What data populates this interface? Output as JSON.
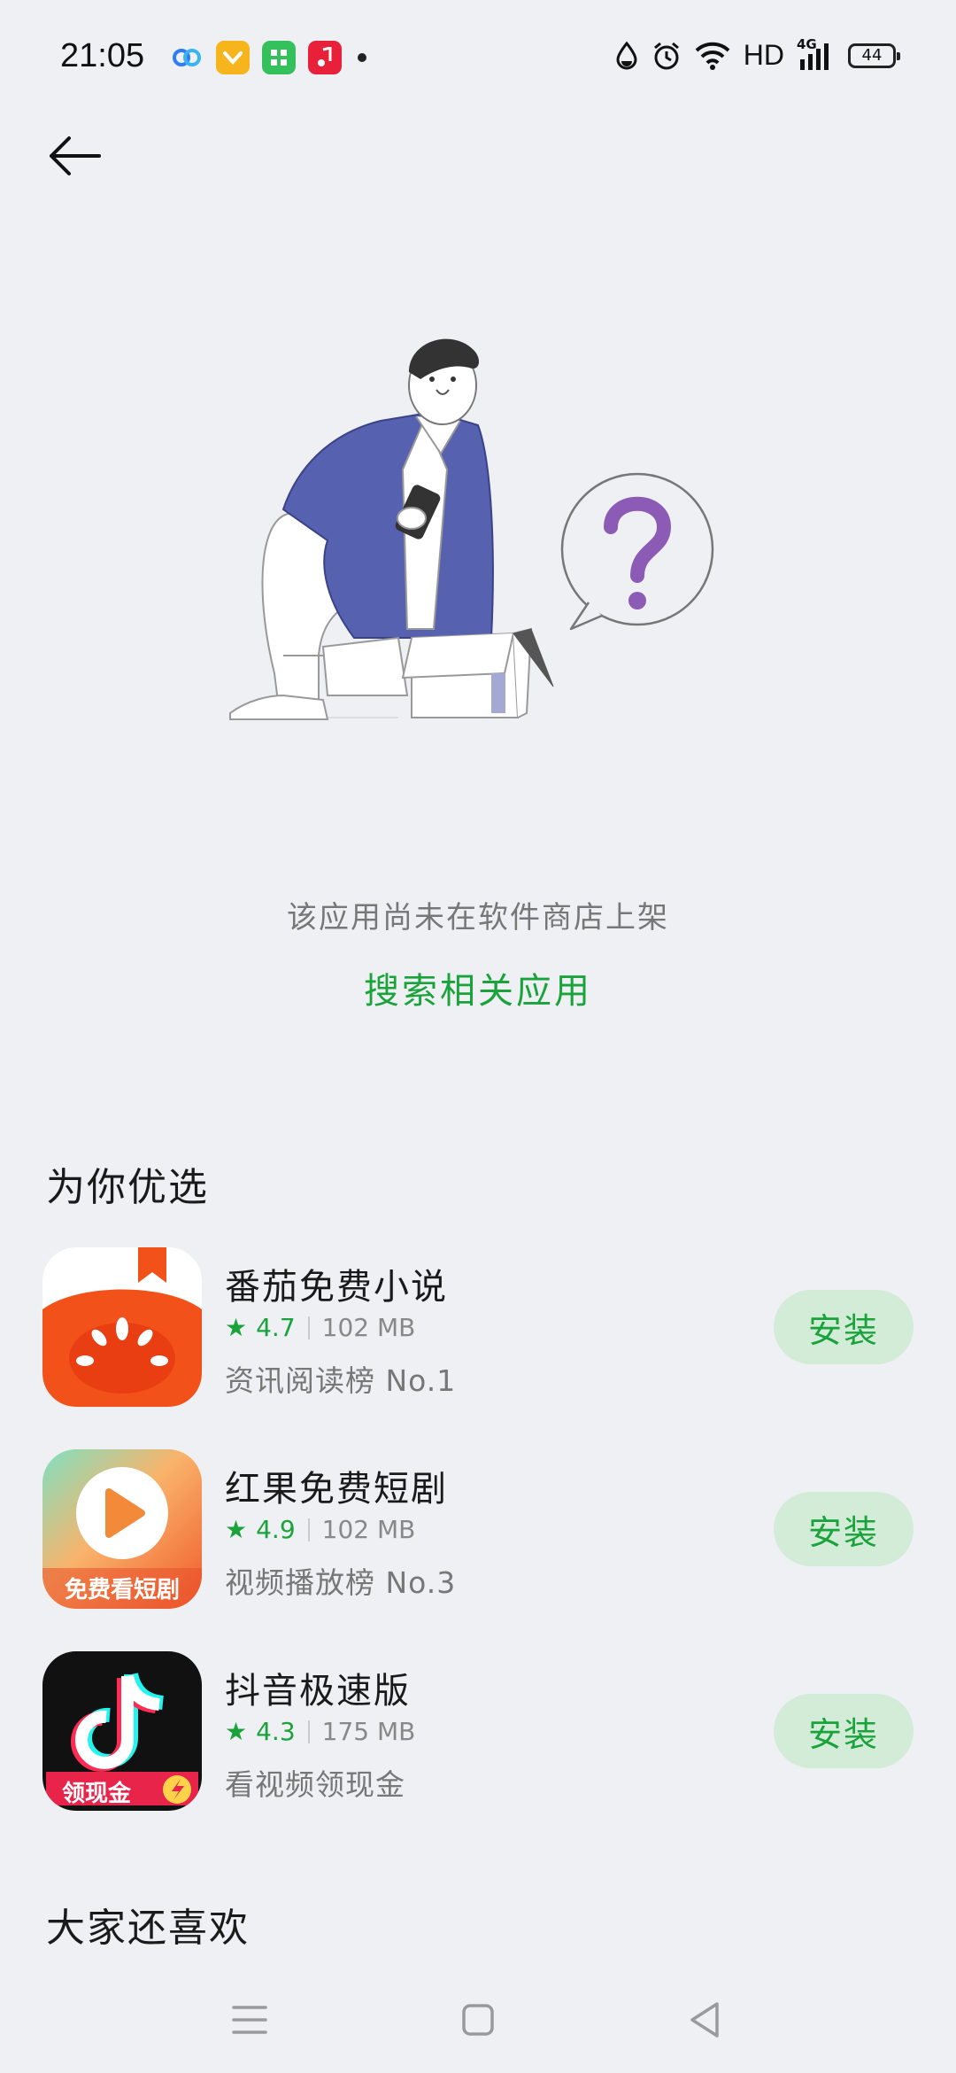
{
  "status_bar": {
    "time": "21:05",
    "notification_icons": [
      {
        "name": "baidu-netdisk-icon",
        "color": "#2f7cf6"
      },
      {
        "name": "coupon-app-icon",
        "color": "#f6b51c"
      },
      {
        "name": "green-app-icon",
        "color": "#34c05a"
      },
      {
        "name": "music-app-icon",
        "color": "#e8203a"
      }
    ],
    "network_label": "HD",
    "signal_label": "4G",
    "battery": "44"
  },
  "empty_state": {
    "message": "该应用尚未在软件商店上架",
    "search_link": "搜索相关应用"
  },
  "recommended": {
    "title": "为你优选",
    "apps": [
      {
        "name": "番茄免费小说",
        "rating": "4.7",
        "size": "102 MB",
        "desc": "资讯阅读榜 No.1",
        "install_label": "安装",
        "icon": "fanqie-novel-icon"
      },
      {
        "name": "红果免费短剧",
        "rating": "4.9",
        "size": "102 MB",
        "desc": "视频播放榜 No.3",
        "install_label": "安装",
        "icon": "hongguo-drama-icon",
        "icon_caption": "免费看短剧"
      },
      {
        "name": "抖音极速版",
        "rating": "4.3",
        "size": "175 MB",
        "desc": "看视频领现金",
        "install_label": "安装",
        "icon": "douyin-lite-icon",
        "icon_caption": "领现金"
      }
    ]
  },
  "also_like": {
    "title": "大家还喜欢"
  },
  "colors": {
    "accent": "#1aa33b",
    "install_bg": "#d3ecd8",
    "background": "#eff0f3"
  }
}
